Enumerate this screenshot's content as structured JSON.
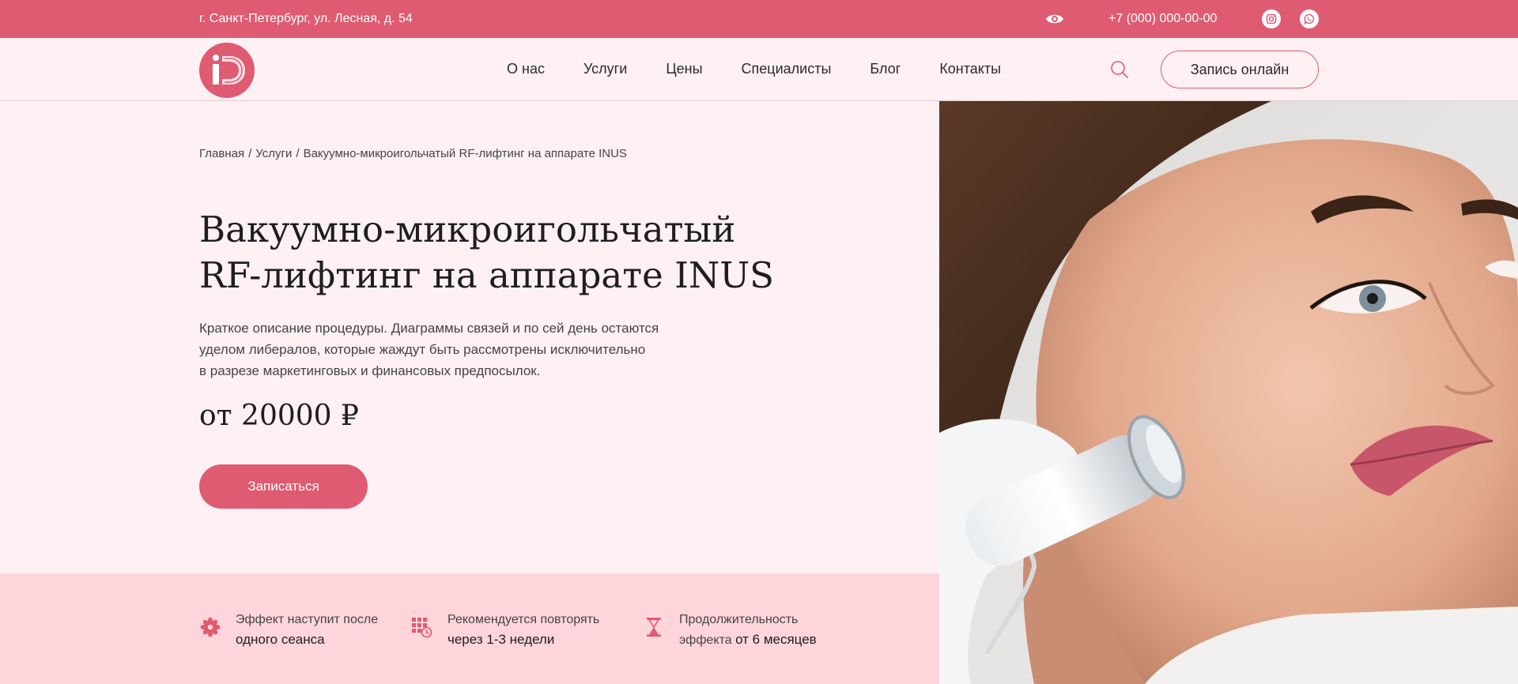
{
  "topbar": {
    "address": "г. Санкт-Петербург, ул. Лесная, д. 54",
    "phone": "+7 (000) 000-00-00",
    "icons": [
      "eye-icon",
      "instagram-icon",
      "whatsapp-icon"
    ]
  },
  "header": {
    "logo_text": "iD",
    "nav": [
      "О нас",
      "Услуги",
      "Цены",
      "Специалисты",
      "Блог",
      "Контакты"
    ],
    "search_icon": "search-icon",
    "book_online_label": "Запись онлайн"
  },
  "hero": {
    "breadcrumb": [
      "Главная",
      "Услуги",
      "Вакуумно-микроигольчатый RF-лифтинг на аппарате INUS"
    ],
    "breadcrumb_separator": "/",
    "title_line1": "Вакуумно-микроигольчатый",
    "title_line2": "RF-лифтинг на аппарате INUS",
    "desc_line1": "Краткое описание процедуры. Диаграммы связей и по сей день остаются",
    "desc_line2": "уделом либералов, которые жаждут быть рассмотрены исключительно",
    "desc_line3": "в разрезе маркетинговых и финансовых предпосылок.",
    "price": "от 20000 ₽",
    "cta_label": "Записаться"
  },
  "features": [
    {
      "icon": "flower-icon",
      "line1": "Эффект наступит после",
      "line2_strong": "одного сеанса"
    },
    {
      "icon": "calendar-clock-icon",
      "line1": "Рекомендуется повторять",
      "line2_strong": "через 1-3 недели"
    },
    {
      "icon": "hourglass-icon",
      "line1": "Продолжительность",
      "line2_plain": "эффекта ",
      "line2_strong": "от 6 месяцев"
    }
  ],
  "colors": {
    "accent": "#df5b72",
    "background": "#fff0f4",
    "features_bg": "#ffd5dc"
  }
}
